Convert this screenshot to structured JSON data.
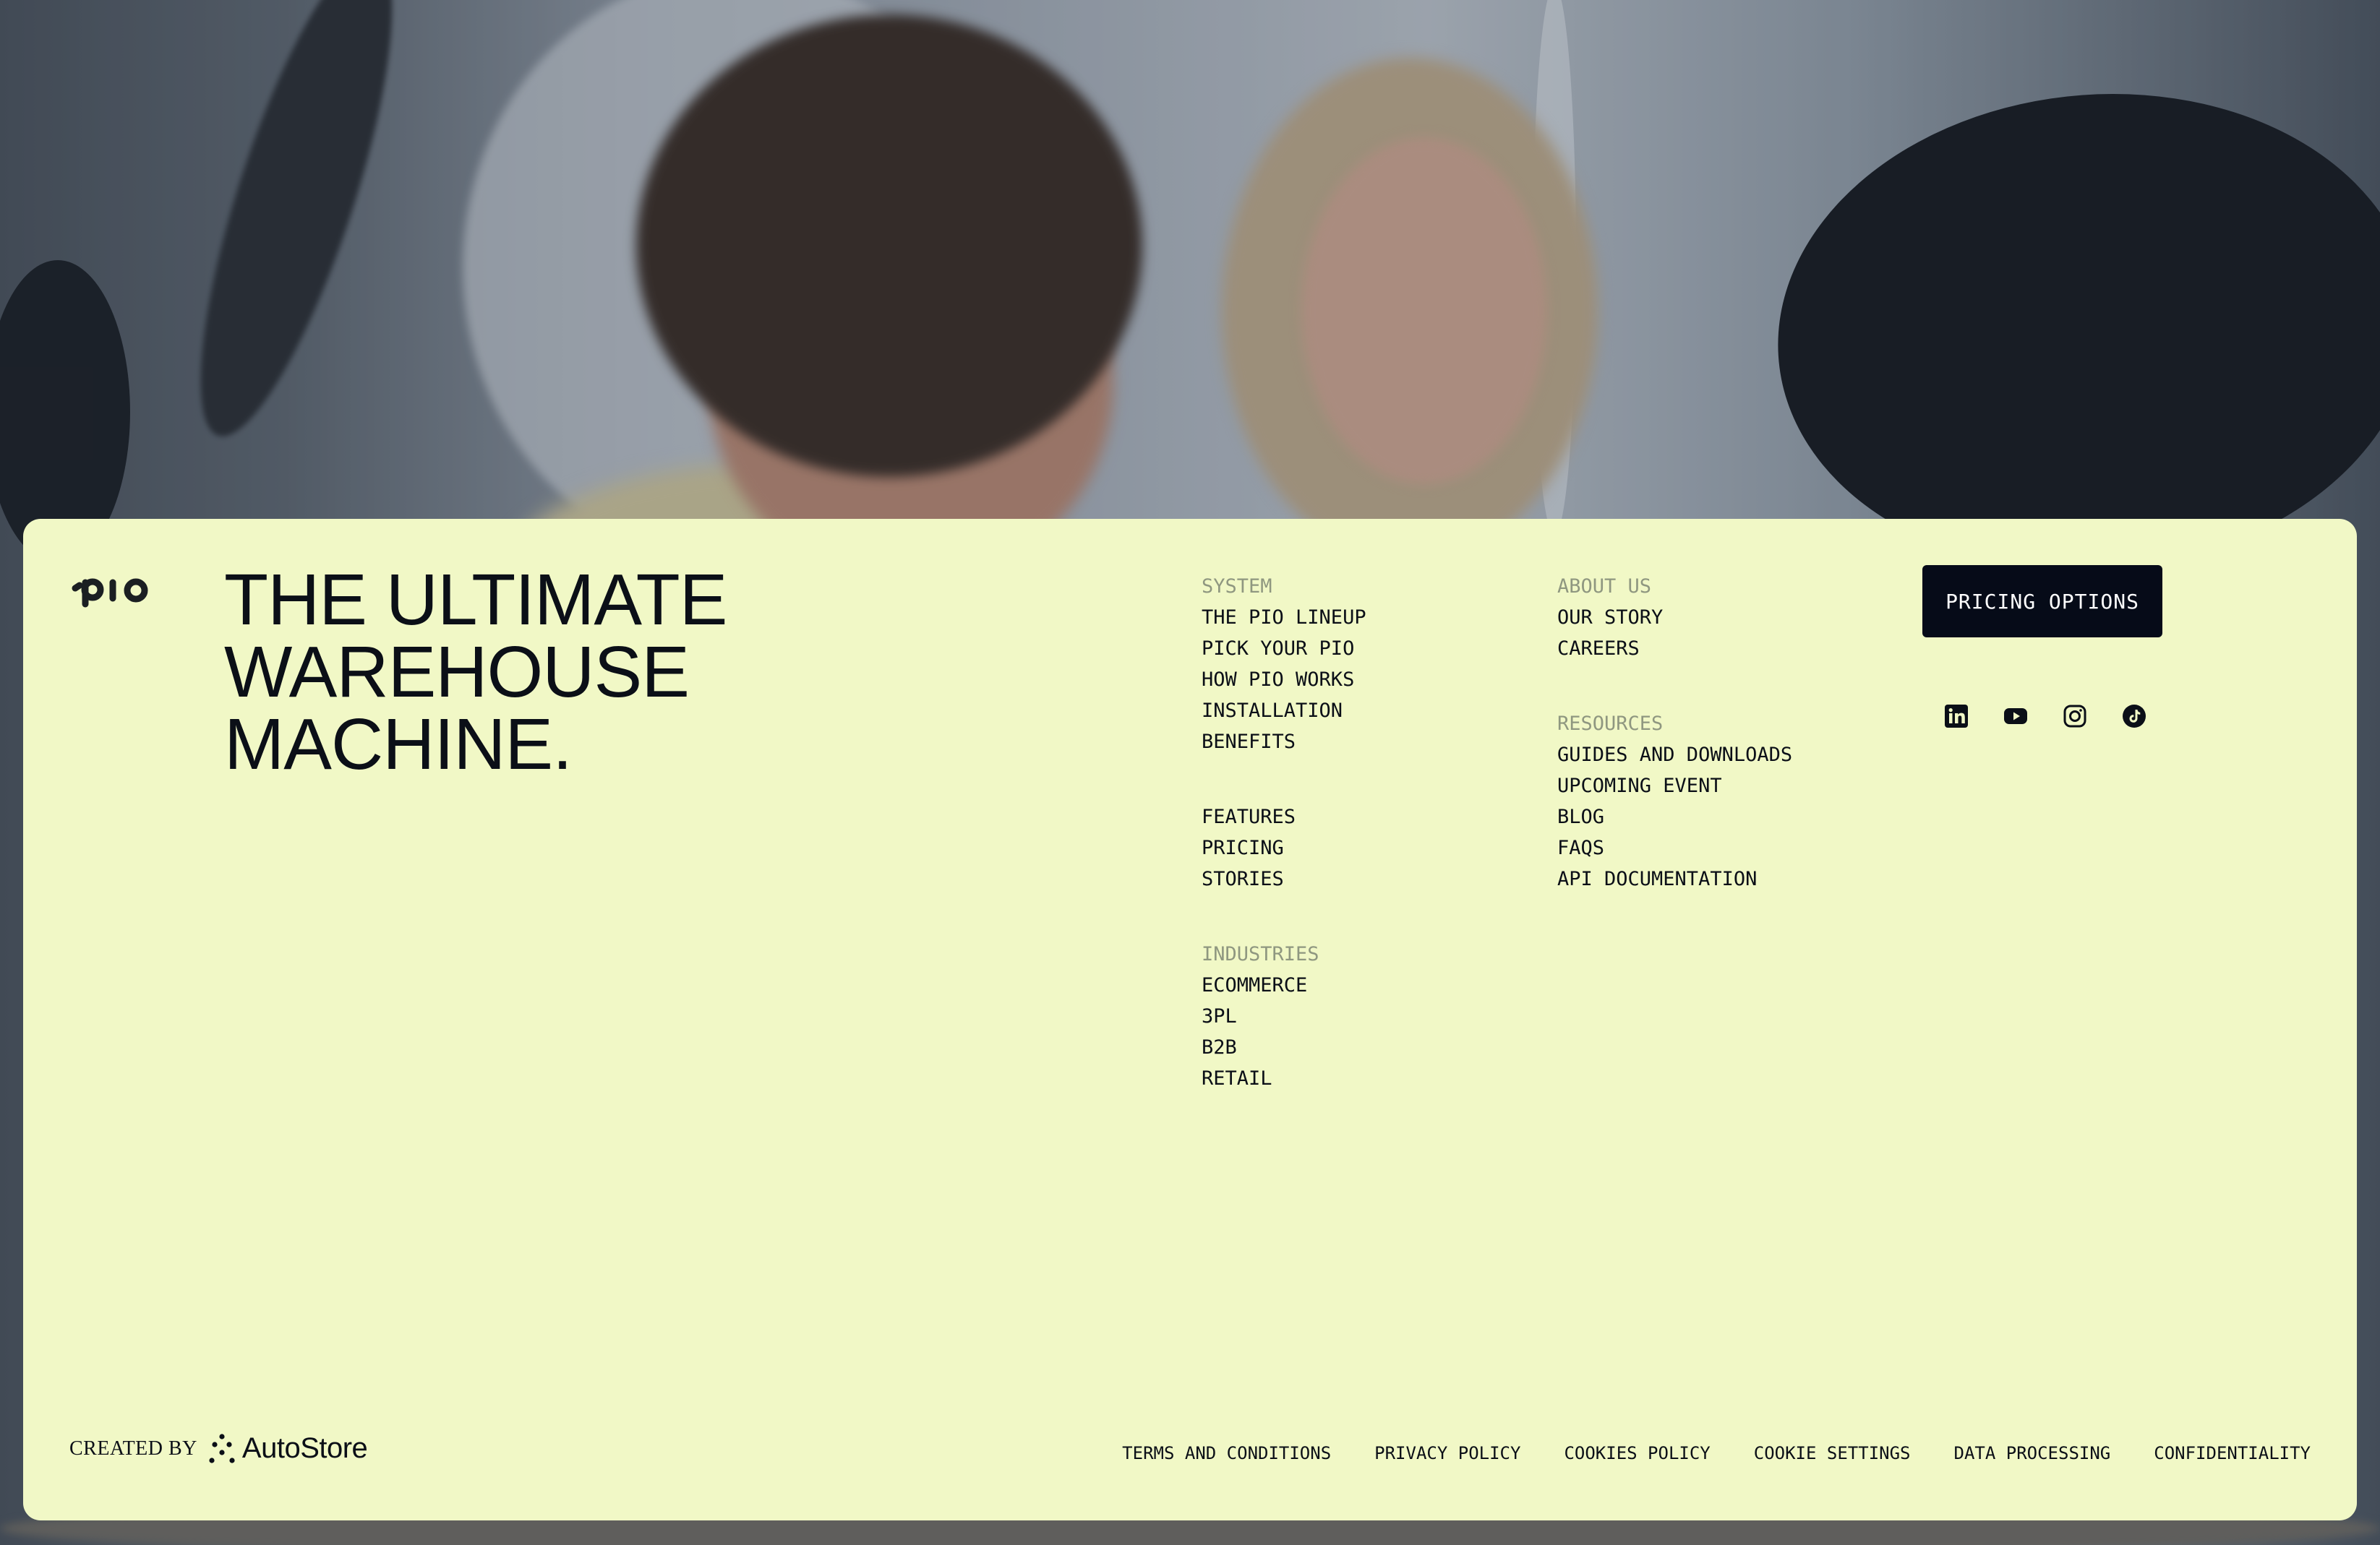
{
  "brand": {
    "logo_text": "pio"
  },
  "headline": {
    "line1": "THE ULTIMATE",
    "line2": "WAREHOUSE",
    "line3": "MACHINE."
  },
  "nav": {
    "system": {
      "heading": "SYSTEM",
      "links": [
        "THE PIO LINEUP",
        "PICK YOUR PIO",
        "HOW PIO WORKS",
        "INSTALLATION",
        "BENEFITS"
      ]
    },
    "more": {
      "links": [
        "FEATURES",
        "PRICING",
        "STORIES"
      ]
    },
    "industries": {
      "heading": "INDUSTRIES",
      "links": [
        "ECOMMERCE",
        "3PL",
        "B2B",
        "RETAIL"
      ]
    },
    "about": {
      "heading": "ABOUT US",
      "links": [
        "OUR STORY",
        "CAREERS"
      ]
    },
    "resources": {
      "heading": "RESOURCES",
      "links": [
        "GUIDES AND DOWNLOADS",
        "UPCOMING EVENT",
        "BLOG",
        "FAQS",
        "API DOCUMENTATION"
      ]
    }
  },
  "cta": {
    "pricing_label": "PRICING OPTIONS"
  },
  "socials": [
    "linkedin-icon",
    "youtube-icon",
    "instagram-icon",
    "tiktok-icon"
  ],
  "footer": {
    "created_by": "CREATED BY",
    "partner": "AutoStore",
    "legal": [
      "TERMS AND CONDITIONS",
      "PRIVACY POLICY",
      "COOKIES POLICY",
      "COOKIE SETTINGS",
      "DATA PROCESSING",
      "CONFIDENTIALITY"
    ]
  },
  "colors": {
    "panel": "#f1f8c6",
    "ink": "#0b0f17",
    "muted": "#8f9780",
    "button": "#060b18"
  }
}
